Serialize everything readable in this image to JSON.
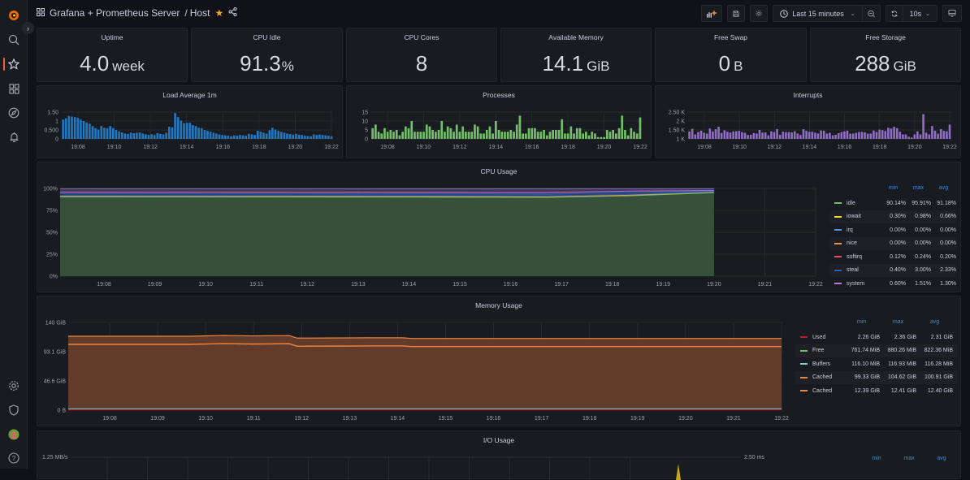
{
  "topbar": {
    "breadcrumb_folder": "Grafana + Prometheus Server",
    "breadcrumb_sep": "/",
    "breadcrumb_dashboard": "Host",
    "time_range": "Last 15 minutes",
    "refresh_interval": "10s"
  },
  "sidebar": {
    "items": [
      "grafana-logo",
      "search",
      "starred",
      "dashboards",
      "explore",
      "alerting",
      "configuration",
      "server-admin",
      "user-avatar",
      "help"
    ]
  },
  "stats": [
    {
      "title": "Uptime",
      "value": "4.0",
      "unit": "week"
    },
    {
      "title": "CPU Idle",
      "value": "91.3",
      "unit": "%"
    },
    {
      "title": "CPU Cores",
      "value": "8",
      "unit": ""
    },
    {
      "title": "Available Memory",
      "value": "14.1",
      "unit": "GiB"
    },
    {
      "title": "Free Swap",
      "value": "0",
      "unit": "B"
    },
    {
      "title": "Free Storage",
      "value": "288",
      "unit": "GiB"
    }
  ],
  "chart_data": [
    {
      "type": "bar",
      "title": "Load Average 1m",
      "color": "#1f78c1",
      "yticks": [
        "1.50",
        "1",
        "0.500",
        "0"
      ],
      "ylim": [
        0,
        1.5
      ],
      "xticks": [
        "19:08",
        "19:10",
        "19:12",
        "19:14",
        "19:16",
        "19:18",
        "19:20",
        "19:22"
      ],
      "values": [
        1.08,
        1.15,
        1.28,
        1.25,
        1.22,
        1.18,
        1.08,
        1.0,
        0.92,
        0.85,
        0.72,
        0.6,
        0.52,
        0.72,
        0.62,
        0.6,
        0.72,
        0.6,
        0.5,
        0.42,
        0.36,
        0.3,
        0.28,
        0.35,
        0.32,
        0.34,
        0.36,
        0.3,
        0.26,
        0.22,
        0.26,
        0.22,
        0.32,
        0.28,
        0.25,
        0.34,
        0.68,
        0.65,
        1.45,
        1.22,
        1.02,
        0.88,
        0.9,
        0.9,
        0.77,
        0.72,
        0.62,
        0.6,
        0.5,
        0.45,
        0.4,
        0.35,
        0.3,
        0.25,
        0.22,
        0.2,
        0.18,
        0.15,
        0.2,
        0.18,
        0.22,
        0.2,
        0.18,
        0.28,
        0.25,
        0.22,
        0.45,
        0.4,
        0.35,
        0.3,
        0.48,
        0.62,
        0.52,
        0.45,
        0.4,
        0.35,
        0.3,
        0.27,
        0.24,
        0.28,
        0.24,
        0.22,
        0.18,
        0.16,
        0.15,
        0.25,
        0.22,
        0.24,
        0.22,
        0.2,
        0.18,
        0.15
      ]
    },
    {
      "type": "bar",
      "title": "Processes",
      "color": "#73bf69",
      "yticks": [
        "15",
        "10",
        "5",
        "0"
      ],
      "ylim": [
        0,
        15
      ],
      "xticks": [
        "19:08",
        "19:10",
        "19:12",
        "19:14",
        "19:16",
        "19:18",
        "19:20",
        "19:22"
      ],
      "values": [
        6,
        8,
        4,
        3,
        6,
        4,
        5,
        4,
        5,
        2,
        4,
        7,
        6,
        10,
        4,
        4,
        4,
        4,
        8,
        7,
        5,
        4,
        5,
        10,
        4,
        7,
        6,
        4,
        8,
        4,
        7,
        4,
        4,
        4,
        8,
        7,
        3,
        3,
        5,
        7,
        3,
        10,
        5,
        4,
        4,
        4,
        5,
        4,
        8,
        13,
        3,
        3,
        6,
        6,
        6,
        4,
        4,
        5,
        2,
        4,
        5,
        5,
        5,
        11,
        3,
        3,
        7,
        3,
        6,
        6,
        3,
        4,
        2,
        4,
        3,
        1,
        1,
        1,
        5,
        4,
        5,
        3,
        6,
        13,
        5,
        2,
        6,
        4,
        3,
        12
      ]
    },
    {
      "type": "bar",
      "title": "Interrupts",
      "color": "#8f6ec6",
      "yticks": [
        "2.50 K",
        "2 K",
        "1.50 K",
        "1 K"
      ],
      "ylim": [
        1000,
        2500
      ],
      "xticks": [
        "19:08",
        "19:10",
        "19:12",
        "19:14",
        "19:16",
        "19:18",
        "19:20",
        "19:22"
      ],
      "values": [
        1420,
        1560,
        1250,
        1380,
        1460,
        1350,
        1300,
        1580,
        1420,
        1540,
        1680,
        1330,
        1480,
        1400,
        1350,
        1420,
        1430,
        1450,
        1380,
        1340,
        1220,
        1230,
        1330,
        1300,
        1500,
        1350,
        1360,
        1200,
        1420,
        1380,
        1550,
        1230,
        1400,
        1380,
        1380,
        1360,
        1430,
        1300,
        1220,
        1540,
        1450,
        1390,
        1400,
        1350,
        1300,
        1470,
        1450,
        1300,
        1340,
        1200,
        1230,
        1320,
        1380,
        1420,
        1460,
        1290,
        1300,
        1340,
        1390,
        1390,
        1370,
        1290,
        1300,
        1470,
        1390,
        1520,
        1490,
        1440,
        1620,
        1580,
        1680,
        1600,
        1400,
        1250,
        1250,
        1120,
        1080,
        1250,
        1420,
        1250,
        2380,
        1350,
        1250,
        1720,
        1460,
        1290,
        1550,
        1450,
        1420,
        1800
      ]
    },
    {
      "type": "area",
      "title": "CPU Usage",
      "yticks": [
        "100%",
        "75%",
        "50%",
        "25%",
        "0%"
      ],
      "ylim": [
        0,
        100
      ],
      "xticks": [
        "19:08",
        "19:09",
        "19:10",
        "19:11",
        "19:12",
        "19:13",
        "19:14",
        "19:15",
        "19:16",
        "19:17",
        "19:18",
        "19:19",
        "19:20",
        "19:21",
        "19:22"
      ],
      "legend_headers": [
        "min",
        "max",
        "avg"
      ],
      "series": [
        {
          "name": "idle",
          "color": "#73bf69",
          "min": "90.14%",
          "max": "95.91%",
          "avg": "91.18%"
        },
        {
          "name": "iowait",
          "color": "#fade2a",
          "min": "0.30%",
          "max": "0.98%",
          "avg": "0.66%"
        },
        {
          "name": "irq",
          "color": "#5794f2",
          "min": "0.00%",
          "max": "0.00%",
          "avg": "0.00%"
        },
        {
          "name": "nice",
          "color": "#ff9830",
          "min": "0.00%",
          "max": "0.00%",
          "avg": "0.00%"
        },
        {
          "name": "softirq",
          "color": "#f2495c",
          "min": "0.12%",
          "max": "0.24%",
          "avg": "0.20%"
        },
        {
          "name": "steal",
          "color": "#1f60c4",
          "min": "0.40%",
          "max": "3.00%",
          "avg": "2.33%"
        },
        {
          "name": "system",
          "color": "#b877d9",
          "min": "0.60%",
          "max": "1.51%",
          "avg": "1.30%"
        }
      ]
    },
    {
      "type": "area",
      "title": "Memory Usage",
      "yticks": [
        "140 GiB",
        "93.1 GiB",
        "46.6 GiB",
        "0 B"
      ],
      "ylim": [
        0,
        140
      ],
      "xticks": [
        "19:08",
        "19:09",
        "19:10",
        "19:11",
        "19:12",
        "19:13",
        "19:14",
        "19:15",
        "19:16",
        "19:17",
        "19:18",
        "19:19",
        "19:20",
        "19:21",
        "19:22"
      ],
      "legend_headers": [
        "min",
        "max",
        "avg"
      ],
      "series": [
        {
          "name": "Used",
          "color": "#c4162a",
          "min": "2.26 GiB",
          "max": "2.36 GiB",
          "avg": "2.31 GiB"
        },
        {
          "name": "Free",
          "color": "#73bf69",
          "min": "761.74 MiB",
          "max": "880.26 MiB",
          "avg": "822.36 MiB"
        },
        {
          "name": "Buffers",
          "color": "#6ed0e0",
          "min": "116.10 MiB",
          "max": "116.93 MiB",
          "avg": "116.28 MiB"
        },
        {
          "name": "Cached",
          "color": "#ef843c",
          "min": "99.33 GiB",
          "max": "104.62 GiB",
          "avg": "100.91 GiB"
        },
        {
          "name": "Cached",
          "color": "#ef843c",
          "min": "12.39 GiB",
          "max": "12.41 GiB",
          "avg": "12.40 GiB"
        }
      ]
    },
    {
      "type": "line",
      "title": "I/O Usage",
      "yticks_left": [
        "1.25 MB/s"
      ],
      "yticks_right": [
        "2.50 ms"
      ],
      "legend_headers": [
        "min",
        "max",
        "avg"
      ]
    }
  ]
}
